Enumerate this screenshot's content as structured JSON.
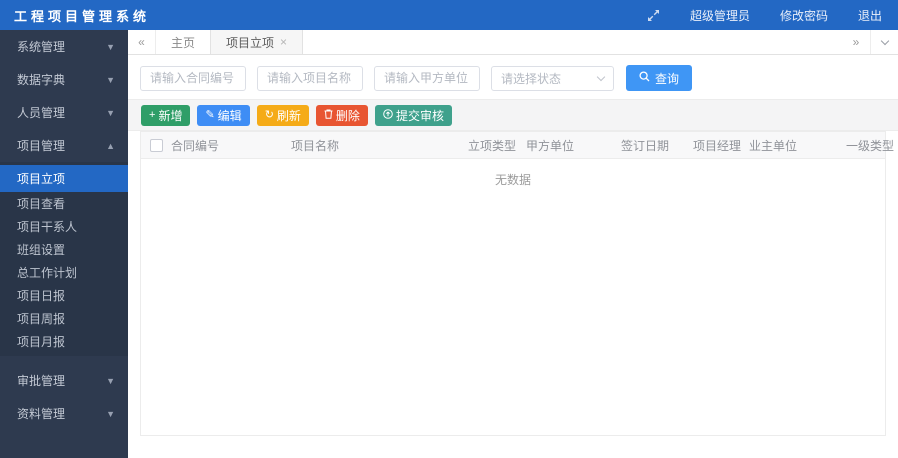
{
  "header": {
    "title": "工程项目管理系统",
    "user": "超级管理员",
    "change_password": "修改密码",
    "logout": "退出"
  },
  "sidebar": {
    "items": [
      {
        "label": "系统管理",
        "expanded": false
      },
      {
        "label": "数据字典",
        "expanded": false
      },
      {
        "label": "人员管理",
        "expanded": false
      },
      {
        "label": "项目管理",
        "expanded": true
      },
      {
        "label": "项目立项",
        "active": true
      },
      {
        "label": "项目查看"
      },
      {
        "label": "项目干系人"
      },
      {
        "label": "班组设置"
      },
      {
        "label": "总工作计划"
      },
      {
        "label": "项目日报"
      },
      {
        "label": "项目周报"
      },
      {
        "label": "项目月报"
      },
      {
        "label": "审批管理",
        "expanded": false
      },
      {
        "label": "资料管理",
        "expanded": false
      }
    ]
  },
  "tabs": {
    "home": "主页",
    "active": "项目立项"
  },
  "filters": {
    "contract_no_placeholder": "请输入合同编号",
    "project_name_placeholder": "请输入项目名称",
    "party_a_placeholder": "请输入甲方单位",
    "status_placeholder": "请选择状态",
    "search_label": "查询"
  },
  "toolbar": {
    "add": "新增",
    "edit": "编辑",
    "refresh": "刷新",
    "delete": "删除",
    "submit_review": "提交审核"
  },
  "table": {
    "columns": [
      "合同编号",
      "项目名称",
      "立项类型",
      "甲方单位",
      "签订日期",
      "项目经理",
      "业主单位",
      "一级类型"
    ],
    "empty_text": "无数据"
  },
  "colors": {
    "header_blue": "#2368c4",
    "sidebar_dark": "#2e3a4f",
    "active_item_blue": "#2368c4",
    "btn_add_green": "#2f9e68",
    "btn_edit_blue": "#3e8df5",
    "btn_refresh_amber": "#f5ab18",
    "btn_delete_red": "#e85532",
    "btn_submit_teal": "#3fa18c",
    "btn_search_blue": "#3f96f5"
  }
}
